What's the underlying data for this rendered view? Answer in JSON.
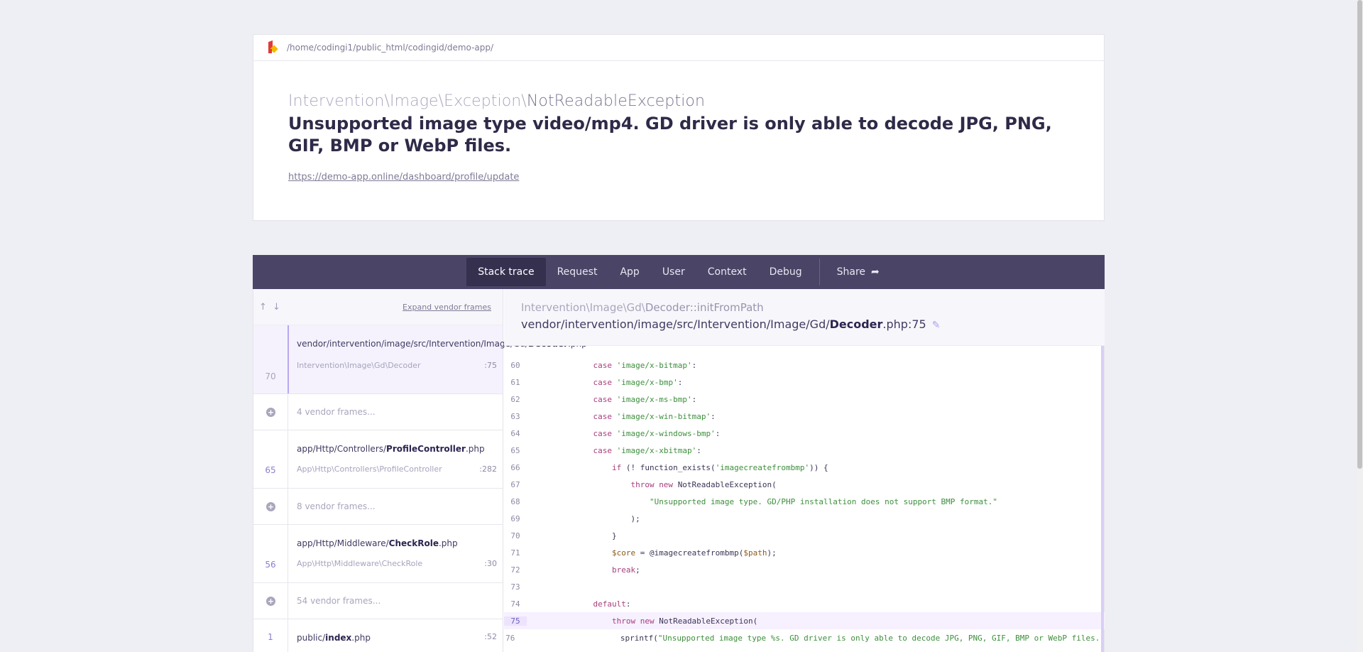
{
  "header": {
    "path": "/home/codingi1/public_html/codingid/demo-app/",
    "exception_namespace": "Intervention\\Image\\Exception\\",
    "exception_class": "NotReadableException",
    "message": "Unsupported image type video/mp4. GD driver is only able to decode JPG, PNG, GIF, BMP or WebP files.",
    "url": "https://demo-app.online/dashboard/profile/update"
  },
  "tabs": {
    "stack_trace": "Stack trace",
    "request": "Request",
    "app": "App",
    "user": "User",
    "context": "Context",
    "debug": "Debug",
    "share": "Share"
  },
  "frames": {
    "arrows": "↑ ↓",
    "expand_label": "Expand vendor frames",
    "f1": {
      "file_prefix": "vendor/intervention/image/src/Intervention/Image/Gd/",
      "file_name": "Decoder",
      "file_ext": ".php",
      "class": "Intervention\\Image\\Gd\\Decoder",
      "line": ":75",
      "num": "70"
    },
    "v1": "4 vendor frames...",
    "f2": {
      "file_prefix": "app/Http/Controllers/",
      "file_name": "ProfileController",
      "file_ext": ".php",
      "class": "App\\Http\\Controllers\\ProfileController",
      "line": ":282",
      "num": "65"
    },
    "v2": "8 vendor frames...",
    "f3": {
      "file_prefix": "app/Http/Middleware/",
      "file_name": "CheckRole",
      "file_ext": ".php",
      "class": "App\\Http\\Middleware\\CheckRole",
      "line": ":30",
      "num": "56"
    },
    "v3": "54 vendor frames...",
    "f4": {
      "file_prefix": "public/",
      "file_name": "index",
      "file_ext": ".php",
      "line": ":52",
      "num": "1"
    }
  },
  "code_view": {
    "class_ns": "Intervention\\Image\\Gd\\",
    "class_method": "Decoder::initFromPath",
    "file_prefix": "vendor/intervention/image/src/Intervention/Image/Gd/",
    "file_name": "Decoder",
    "file_suffix": ".php:75",
    "highlight_line": 75,
    "lines": [
      {
        "n": "60",
        "indent": "            ",
        "parts": [
          [
            "kw",
            "case "
          ],
          [
            "str",
            "'image/x-bitmap'"
          ],
          [
            "",
            ":"
          ]
        ]
      },
      {
        "n": "61",
        "indent": "            ",
        "parts": [
          [
            "kw",
            "case "
          ],
          [
            "str",
            "'image/x-bmp'"
          ],
          [
            "",
            ":"
          ]
        ]
      },
      {
        "n": "62",
        "indent": "            ",
        "parts": [
          [
            "kw",
            "case "
          ],
          [
            "str",
            "'image/x-ms-bmp'"
          ],
          [
            "",
            ":"
          ]
        ]
      },
      {
        "n": "63",
        "indent": "            ",
        "parts": [
          [
            "kw",
            "case "
          ],
          [
            "str",
            "'image/x-win-bitmap'"
          ],
          [
            "",
            ":"
          ]
        ]
      },
      {
        "n": "64",
        "indent": "            ",
        "parts": [
          [
            "kw",
            "case "
          ],
          [
            "str",
            "'image/x-windows-bmp'"
          ],
          [
            "",
            ":"
          ]
        ]
      },
      {
        "n": "65",
        "indent": "            ",
        "parts": [
          [
            "kw",
            "case "
          ],
          [
            "str",
            "'image/x-xbitmap'"
          ],
          [
            "",
            ":"
          ]
        ]
      },
      {
        "n": "66",
        "indent": "                ",
        "parts": [
          [
            "kw",
            "if "
          ],
          [
            "",
            "(! function_exists("
          ],
          [
            "str",
            "'imagecreatefrombmp'"
          ],
          [
            "",
            ")) {"
          ]
        ]
      },
      {
        "n": "67",
        "indent": "                    ",
        "parts": [
          [
            "kw",
            "throw new "
          ],
          [
            "",
            "NotReadableException("
          ]
        ]
      },
      {
        "n": "68",
        "indent": "                        ",
        "parts": [
          [
            "str",
            "\"Unsupported image type. GD/PHP installation does not support BMP format.\""
          ]
        ]
      },
      {
        "n": "69",
        "indent": "                    ",
        "parts": [
          [
            "",
            ");"
          ]
        ]
      },
      {
        "n": "70",
        "indent": "                ",
        "parts": [
          [
            "",
            "}"
          ]
        ]
      },
      {
        "n": "71",
        "indent": "                ",
        "parts": [
          [
            "var",
            "$core"
          ],
          [
            "",
            " = @imagecreatefrombmp("
          ],
          [
            "var",
            "$path"
          ],
          [
            "",
            ");"
          ]
        ]
      },
      {
        "n": "72",
        "indent": "                ",
        "parts": [
          [
            "kw",
            "break"
          ],
          [
            "",
            ";"
          ]
        ]
      },
      {
        "n": "73",
        "indent": "",
        "parts": []
      },
      {
        "n": "74",
        "indent": "            ",
        "parts": [
          [
            "kw",
            "default"
          ],
          [
            "",
            ":"
          ]
        ]
      },
      {
        "n": "75",
        "indent": "                ",
        "parts": [
          [
            "kw",
            "throw new "
          ],
          [
            "",
            "NotReadableException("
          ]
        ]
      },
      {
        "n": "76",
        "indent": "                    ",
        "parts": [
          [
            "",
            "sprintf("
          ],
          [
            "str",
            "\"Unsupported image type %s. GD driver is only able to decode JPG, PNG, GIF, BMP or WebP files.\""
          ]
        ]
      }
    ]
  }
}
